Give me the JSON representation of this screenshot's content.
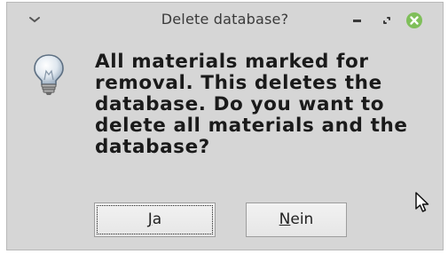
{
  "window": {
    "title": "Delete database?"
  },
  "titlebar": {
    "menu_icon": "chevron-down-icon",
    "minimize_icon": "minimize-icon",
    "maximize_icon": "maximize-icon",
    "close_icon": "close-icon",
    "close_color": "#7fbf5a"
  },
  "dialog": {
    "icon": "lightbulb-icon",
    "message": "All materials marked for removal. This deletes the database. Do you want to delete all materials and the database?"
  },
  "buttons": {
    "yes": {
      "accel": "J",
      "rest": "a"
    },
    "no": {
      "accel": "N",
      "rest": "ein"
    }
  }
}
